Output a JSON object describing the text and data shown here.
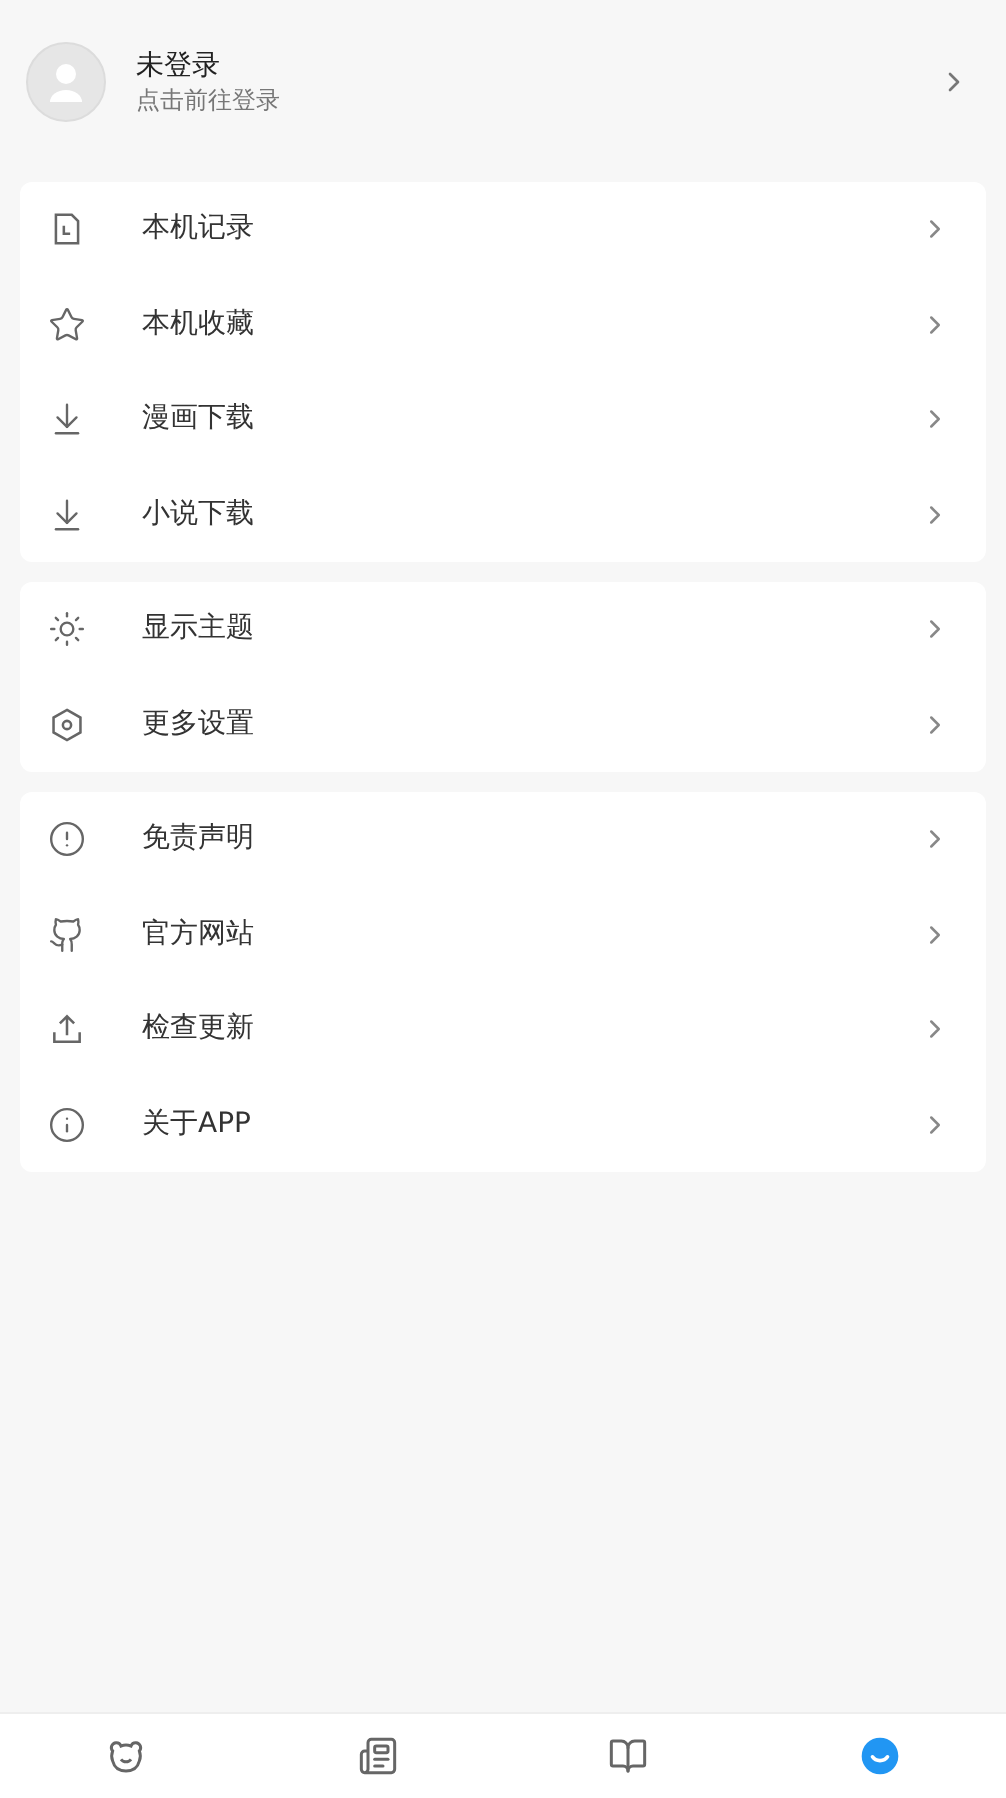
{
  "profile": {
    "name": "未登录",
    "subtitle": "点击前往登录"
  },
  "groups": [
    {
      "items": [
        {
          "kind": "history",
          "label": "本机记录"
        },
        {
          "kind": "star",
          "label": "本机收藏"
        },
        {
          "kind": "download",
          "label": "漫画下载"
        },
        {
          "kind": "download",
          "label": "小说下载"
        }
      ]
    },
    {
      "items": [
        {
          "kind": "theme",
          "label": "显示主题"
        },
        {
          "kind": "settings",
          "label": "更多设置"
        }
      ]
    },
    {
      "items": [
        {
          "kind": "alert",
          "label": "免责声明"
        },
        {
          "kind": "github",
          "label": "官方网站"
        },
        {
          "kind": "upload",
          "label": "检查更新"
        },
        {
          "kind": "info",
          "label": "关于APP"
        }
      ]
    }
  ],
  "tabs": [
    {
      "kind": "bear",
      "selected": false
    },
    {
      "kind": "news",
      "selected": false
    },
    {
      "kind": "book",
      "selected": false
    },
    {
      "kind": "smile",
      "selected": true
    }
  ]
}
